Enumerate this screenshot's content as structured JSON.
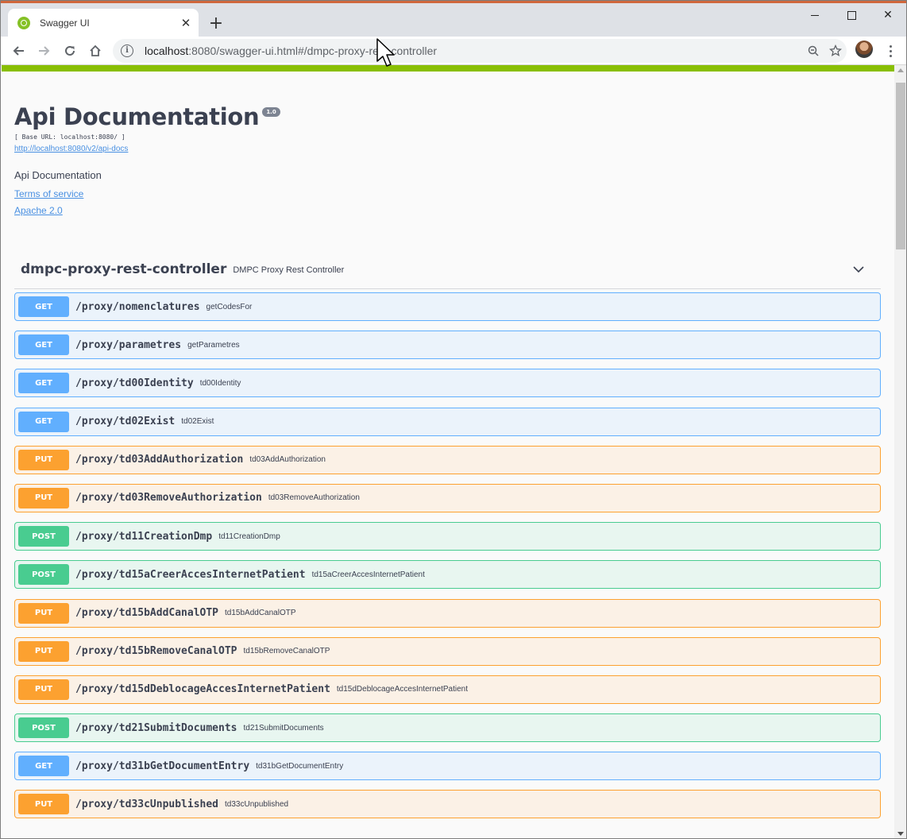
{
  "browser": {
    "tab_title": "Swagger UI",
    "url_host": "localhost",
    "url_rest": ":8080/swagger-ui.html#/dmpc-proxy-rest-controller",
    "icons": [
      "back-icon",
      "forward-icon",
      "reload-icon",
      "home-icon",
      "info-icon",
      "zoom-icon",
      "star-icon",
      "menu-icon"
    ]
  },
  "page": {
    "title": "Api Documentation",
    "version": "1.0",
    "base_url": "[ Base URL: localhost:8080/ ]",
    "spec_link": "http://localhost:8080/v2/api-docs",
    "description": "Api Documentation",
    "terms_link": "Terms of service",
    "license_link": "Apache 2.0"
  },
  "tag": {
    "name": "dmpc-proxy-rest-controller",
    "description": "DMPC Proxy Rest Controller"
  },
  "operations": [
    {
      "method": "GET",
      "path": "/proxy/nomenclatures",
      "summary": "getCodesFor"
    },
    {
      "method": "GET",
      "path": "/proxy/parametres",
      "summary": "getParametres"
    },
    {
      "method": "GET",
      "path": "/proxy/td00Identity",
      "summary": "td00Identity"
    },
    {
      "method": "GET",
      "path": "/proxy/td02Exist",
      "summary": "td02Exist"
    },
    {
      "method": "PUT",
      "path": "/proxy/td03AddAuthorization",
      "summary": "td03AddAuthorization"
    },
    {
      "method": "PUT",
      "path": "/proxy/td03RemoveAuthorization",
      "summary": "td03RemoveAuthorization"
    },
    {
      "method": "POST",
      "path": "/proxy/td11CreationDmp",
      "summary": "td11CreationDmp"
    },
    {
      "method": "POST",
      "path": "/proxy/td15aCreerAccesInternetPatient",
      "summary": "td15aCreerAccesInternetPatient"
    },
    {
      "method": "PUT",
      "path": "/proxy/td15bAddCanalOTP",
      "summary": "td15bAddCanalOTP"
    },
    {
      "method": "PUT",
      "path": "/proxy/td15bRemoveCanalOTP",
      "summary": "td15bRemoveCanalOTP"
    },
    {
      "method": "PUT",
      "path": "/proxy/td15dDeblocageAccesInternetPatient",
      "summary": "td15dDeblocageAccesInternetPatient"
    },
    {
      "method": "POST",
      "path": "/proxy/td21SubmitDocuments",
      "summary": "td21SubmitDocuments"
    },
    {
      "method": "GET",
      "path": "/proxy/td31bGetDocumentEntry",
      "summary": "td31bGetDocumentEntry"
    },
    {
      "method": "PUT",
      "path": "/proxy/td33cUnpublished",
      "summary": "td33cUnpublished"
    }
  ],
  "colors": {
    "get": "#61affe",
    "put": "#fca130",
    "post": "#49cc90",
    "top_bar": "#89bf04",
    "link": "#4990e2"
  }
}
